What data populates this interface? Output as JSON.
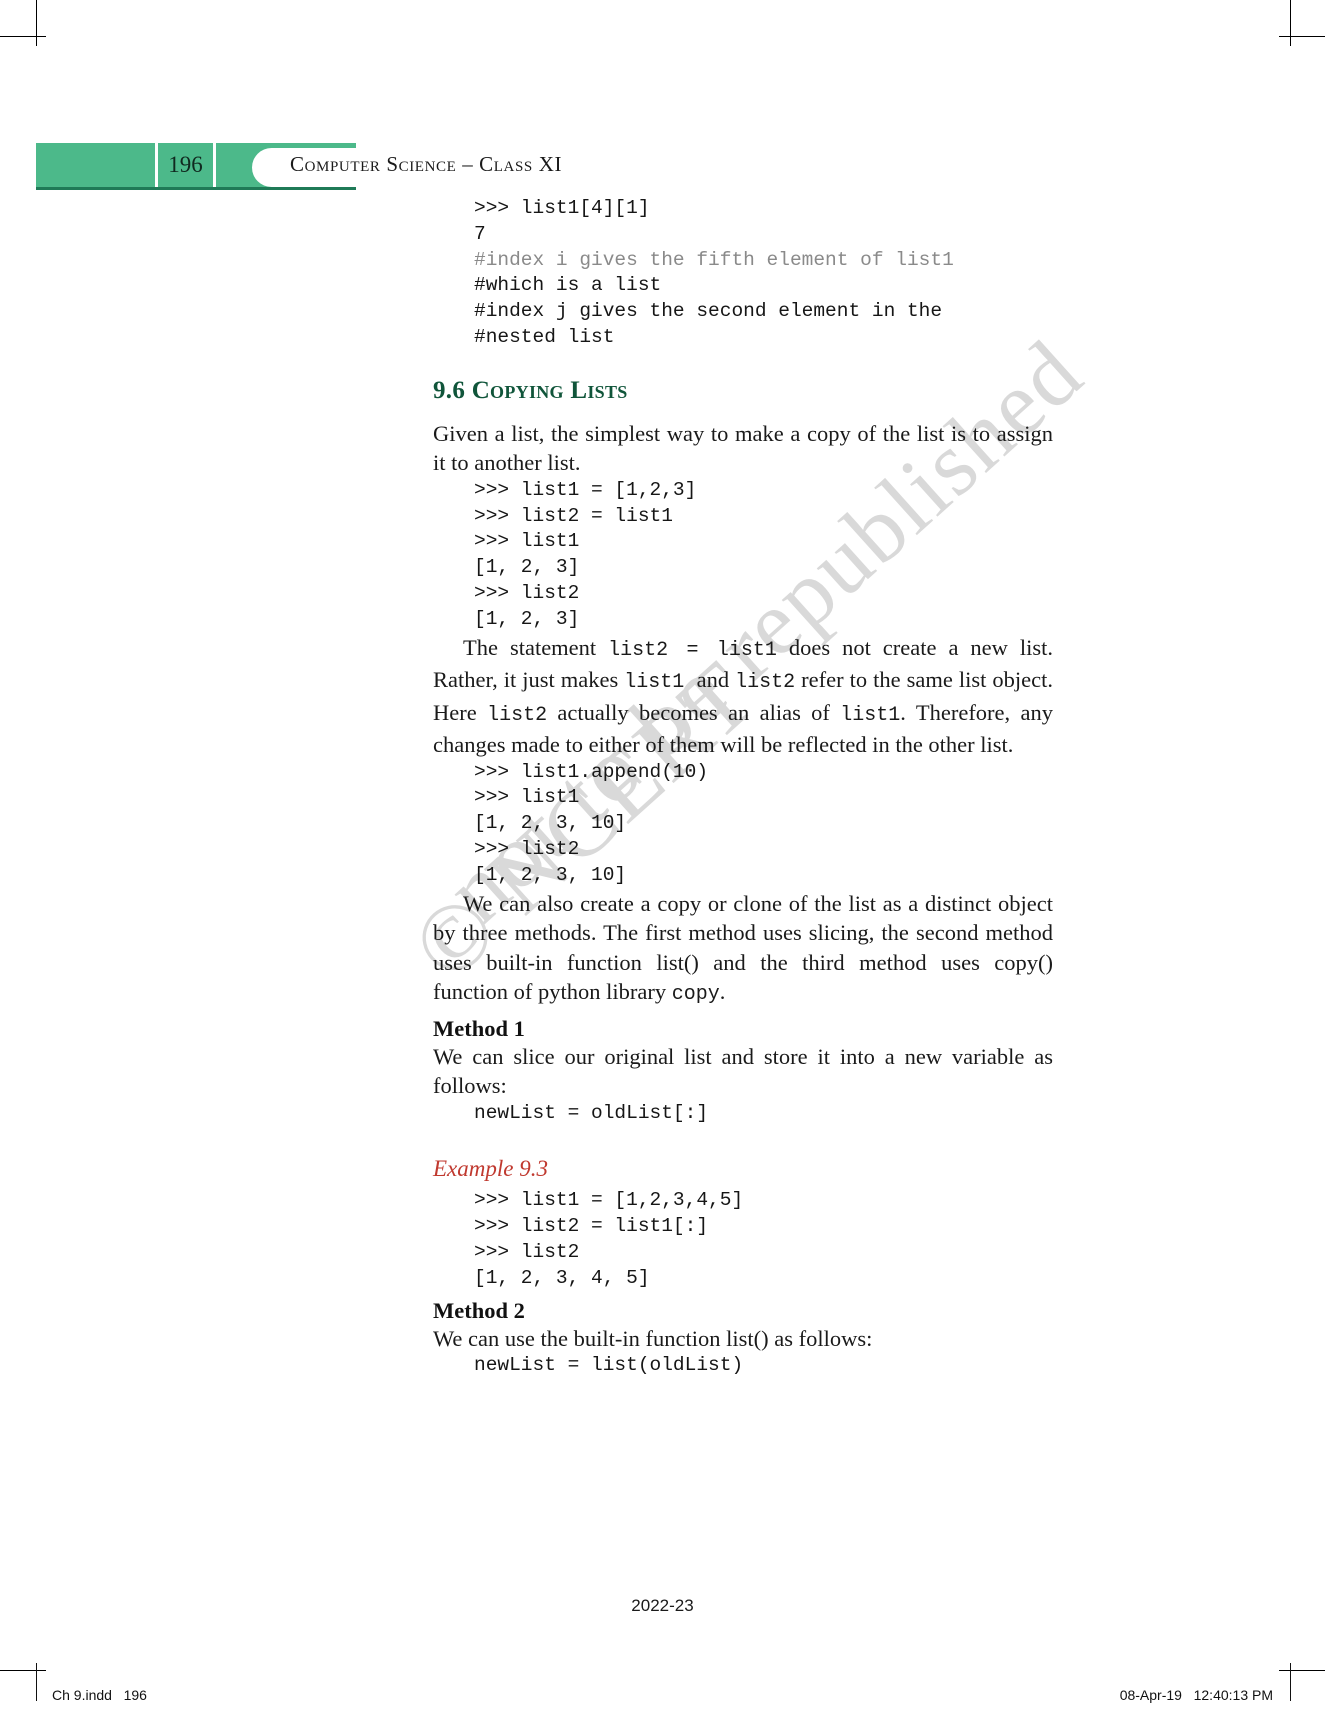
{
  "header": {
    "page_number": "196",
    "running_title": "Computer Science – Class XI",
    "band_color": "#4cb98a",
    "rule_color": "#1f7a57"
  },
  "watermark": {
    "line1": "© NCERT",
    "line2": "not to be republished",
    "color": "#d9d9d9"
  },
  "content": {
    "top_code": [
      {
        "text": ">>> list1[4][1]",
        "dim": false
      },
      {
        "text": "7",
        "dim": false
      },
      {
        "text": "#index i gives the fifth element of list1",
        "dim": true
      },
      {
        "text": "#which is a list",
        "dim": false
      },
      {
        "text": "#index j gives the second element in the",
        "dim": false
      },
      {
        "text": "#nested list",
        "dim": false
      }
    ],
    "section_number": "9.6 ",
    "section_title": "Copying Lists",
    "section_color": "#10553a",
    "para_intro": "Given a list, the simplest way to make a copy of the list is to assign it to another list.",
    "code_block_1": [
      ">>> list1 = [1,2,3]",
      ">>> list2 = list1",
      ">>> list1",
      "[1, 2, 3]",
      ">>> list2",
      "[1, 2, 3]"
    ],
    "para_alias_1": "The statement ",
    "para_alias_code1": "list2 = list1",
    "para_alias_2": " does not create a new list. Rather, it just makes ",
    "para_alias_code2": "list1 ",
    "para_alias_3": " and ",
    "para_alias_code3": "list2",
    "para_alias_4": " refer to the same list object. Here ",
    "para_alias_code4": "list2",
    "para_alias_5": " actually becomes an alias of ",
    "para_alias_code5": "list1",
    "para_alias_6": ". Therefore, any changes made to either of them will be reflected in the other list.",
    "code_block_2": [
      ">>> list1.append(10)",
      ">>> list1",
      "[1, 2, 3, 10]",
      ">>> list2",
      "[1, 2, 3, 10]"
    ],
    "para_clone_1": "We can also create a copy or clone of the list as a distinct object by three methods. The first method uses slicing, the second method uses built-in function list() and the third method uses copy() function of python library ",
    "para_clone_code": "copy",
    "para_clone_2": ".",
    "method1_heading": "Method 1",
    "method1_text": "We can slice our original list and store it into a new variable as follows:",
    "method1_code": "newList = oldList[:]",
    "example_label": "Example 9.3",
    "example_color": "#c0392f",
    "example_code": [
      ">>> list1 = [1,2,3,4,5]",
      ">>> list2 = list1[:]",
      ">>> list2",
      "[1, 2, 3, 4, 5]"
    ],
    "method2_heading": "Method 2",
    "method2_text": "We can use the built-in function list() as follows:",
    "method2_code": "newList = list(oldList)"
  },
  "year_mark": "2022-23",
  "footer": {
    "left": "Ch 9.indd   196",
    "right": "08-Apr-19   12:40:13 PM"
  }
}
